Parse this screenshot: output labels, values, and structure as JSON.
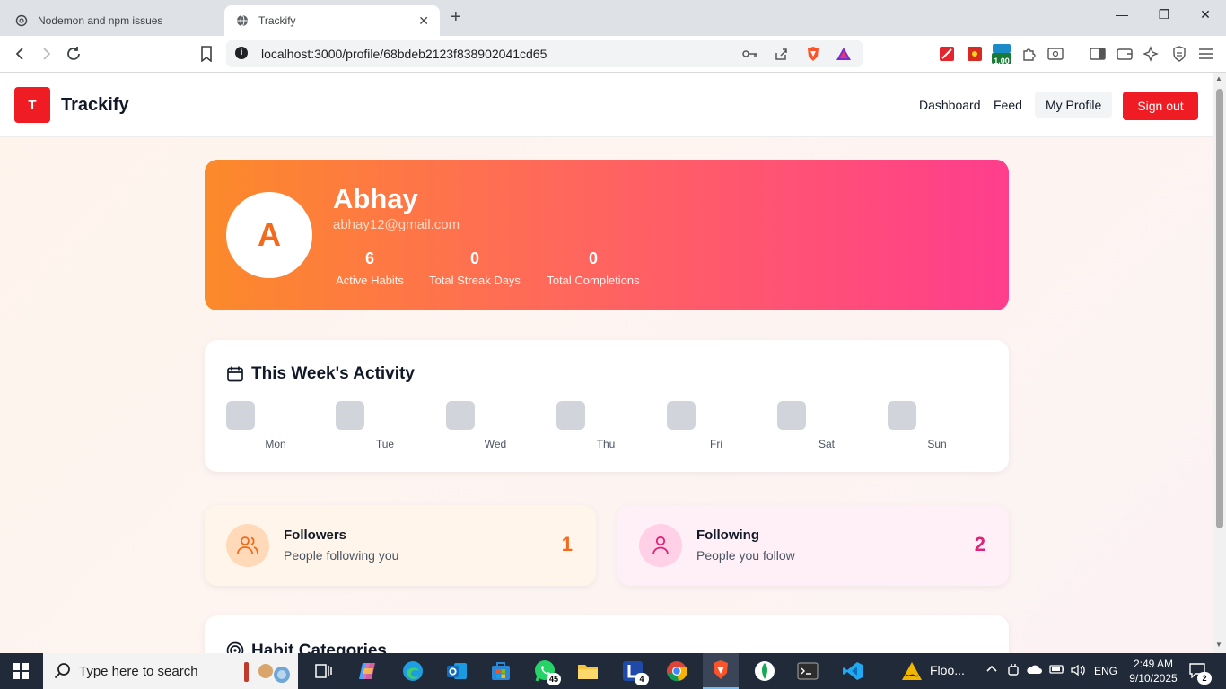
{
  "browser": {
    "tabs": [
      {
        "title": "Nodemon and npm issues",
        "active": false
      },
      {
        "title": "Trackify",
        "active": true
      }
    ],
    "url": "localhost:3000/profile/68bdeb2123f838902041cd65",
    "extension_badge": "1.00"
  },
  "nav": {
    "logo_letter": "T",
    "brand": "Trackify",
    "links": [
      "Dashboard",
      "Feed",
      "My Profile"
    ],
    "signout": "Sign out"
  },
  "profile": {
    "initial": "A",
    "name": "Abhay",
    "email": "abhay12@gmail.com",
    "stats": [
      {
        "value": "6",
        "label": "Active Habits"
      },
      {
        "value": "0",
        "label": "Total Streak Days"
      },
      {
        "value": "0",
        "label": "Total Completions"
      }
    ]
  },
  "week": {
    "title": "This Week's Activity",
    "days": [
      "Mon",
      "Tue",
      "Wed",
      "Thu",
      "Fri",
      "Sat",
      "Sun"
    ]
  },
  "followers": {
    "title": "Followers",
    "subtitle": "People following you",
    "count": "1"
  },
  "following": {
    "title": "Following",
    "subtitle": "People you follow",
    "count": "2"
  },
  "categories": {
    "title": "Habit Categories"
  },
  "taskbar": {
    "search_placeholder": "Type here to search",
    "whatsapp_badge": "45",
    "app_l_badge": "4",
    "flood_label": "Floo...",
    "language": "ENG",
    "time": "2:49 AM",
    "date": "9/10/2025",
    "notifications": "2"
  },
  "colors": {
    "brand_red": "#ef1c24",
    "hero_start": "#fc8a2a",
    "hero_end": "#ff3d8d",
    "followers_accent": "#f26a1b",
    "following_accent": "#e0237a"
  }
}
